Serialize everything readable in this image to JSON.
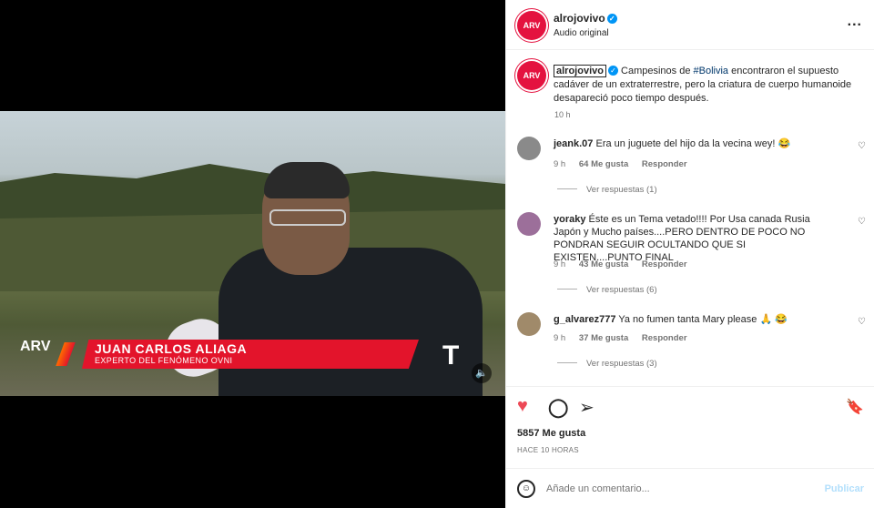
{
  "video": {
    "lower_third_name": "JUAN CARLOS ALIAGA",
    "lower_third_title": "EXPERTO DEL FENÓMENO OVNI",
    "logo_left": "ARV",
    "logo_right": "T",
    "mute_icon": "🔈"
  },
  "header": {
    "avatar": "ARV",
    "username": "alrojovivo",
    "verified_icon": "✓",
    "subtitle": "Audio original",
    "more": "..."
  },
  "caption": {
    "username": "alrojovivo",
    "text_before_hashtag": "Campesinos de ",
    "hashtag": "#Bolivia",
    "text_after_hashtag": " encontraron el supuesto cadáver de un extraterrestre, pero la criatura de cuerpo humanoide desapareció poco tiempo después.",
    "time": "10 h"
  },
  "comments": [
    {
      "username": "jeank.07",
      "text": "Era un juguete del hijo da la vecina wey! 😂",
      "time": "9 h",
      "likes": "64 Me gusta",
      "reply": "Responder",
      "view_replies": "Ver respuestas (1)"
    },
    {
      "username": "yoraky",
      "text": "Éste es un Tema vetado!!!! Por Usa canada Rusia Japón y Mucho países....PERO DENTRO DE POCO NO PONDRAN SEGUIR OCULTANDO QUE SI EXISTEN....PUNTO FINAL",
      "time": "9 h",
      "likes": "43 Me gusta",
      "reply": "Responder",
      "view_replies": "Ver respuestas (6)"
    },
    {
      "username": "g_alvarez777",
      "text": "Ya no fumen tanta Mary please 🙏 😂",
      "time": "9 h",
      "likes": "37 Me gusta",
      "reply": "Responder",
      "view_replies": "Ver respuestas (3)"
    }
  ],
  "actions": {
    "like_icon": "♥",
    "comment_icon": "◯",
    "share_icon": "➢",
    "save_icon": "🔖",
    "likes": "5857 Me gusta",
    "posted": "HACE 10 HORAS"
  },
  "comment_box": {
    "emoji_icon": "☺",
    "placeholder": "Añade un comentario...",
    "publish": "Publicar"
  },
  "colors": {
    "like": "#ed4956",
    "brand_red": "#e3142b",
    "verified": "#0095f6",
    "link": "#00376b"
  }
}
